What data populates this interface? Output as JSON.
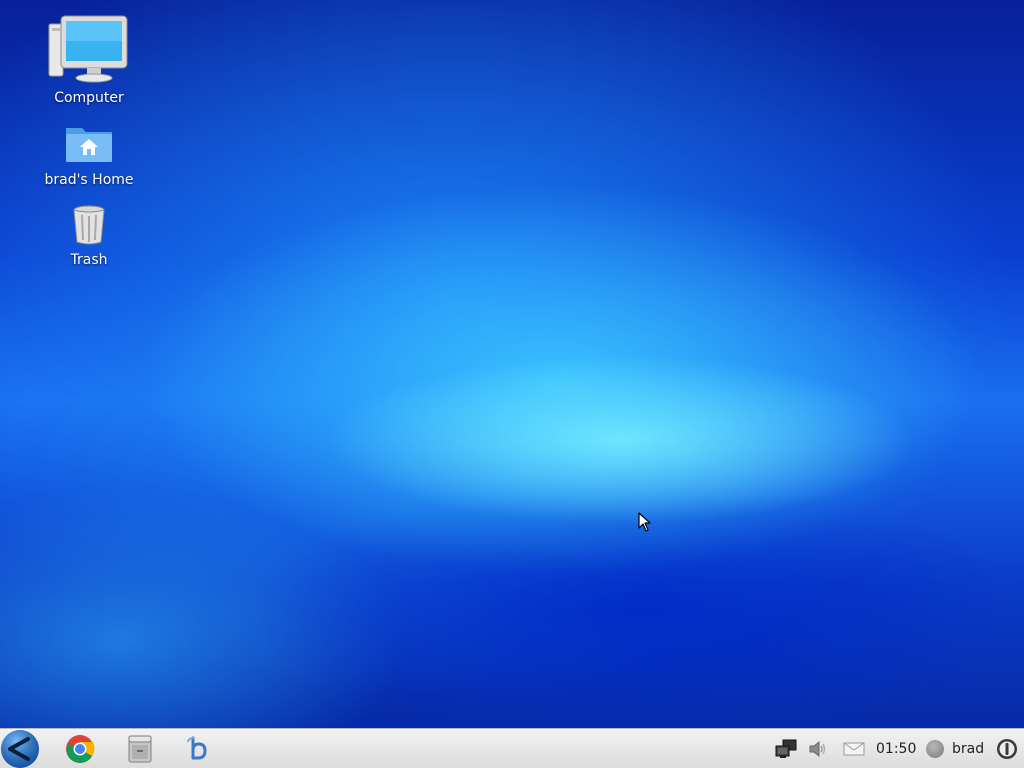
{
  "desktop": {
    "icons": [
      {
        "label": "Computer",
        "icon": "computer-icon"
      },
      {
        "label": "brad's Home",
        "icon": "home-folder-icon"
      },
      {
        "label": "Trash",
        "icon": "trash-icon"
      }
    ]
  },
  "taskbar": {
    "launchers": [
      {
        "icon": "start-menu-icon"
      },
      {
        "icon": "chrome-icon"
      },
      {
        "icon": "file-manager-icon"
      },
      {
        "icon": "app-launcher-icon"
      }
    ],
    "tray": {
      "icons": [
        "network-icon",
        "volume-icon",
        "mail-icon"
      ],
      "clock": "01:50",
      "user": "brad",
      "power_icon": "power-icon"
    }
  },
  "colors": {
    "taskbar_bg": "#e6e6e6",
    "desktop_primary": "#1a6ff0",
    "desktop_highlight": "#6ff0ff"
  }
}
